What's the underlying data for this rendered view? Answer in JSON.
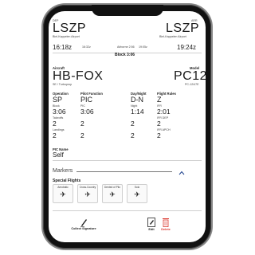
{
  "flight": {
    "dep_label": "DEP",
    "arr_label": "ARR",
    "dep_code": "LSZP",
    "arr_code": "LSZP",
    "dep_name": "Biel-Kappelen Airport",
    "arr_name": "Biel-Kappelen Airport",
    "dep_time": "16:18z",
    "arr_time": "19:24z",
    "tko_time": "16:32z",
    "airborne": "Airborne 2:56",
    "ldg_time": "19:05z",
    "block": "Block 3:06"
  },
  "aircraft": {
    "label": "Aircraft",
    "model_label": "Model",
    "reg": "HB-FOX",
    "model": "PC12",
    "sub": "SE / Turboprop",
    "model_sub": "PC-12/47E"
  },
  "stats": {
    "headers": [
      "Operation",
      "Pilot Function",
      "Day/Night",
      "Flight Rules"
    ],
    "values": [
      "SP",
      "PIC",
      "D-N",
      "Z"
    ],
    "row2_labels": [
      "Block",
      "PIC",
      "Night",
      "IFR"
    ],
    "row2_values": [
      "3:06",
      "3:06",
      "1:14",
      "2:01"
    ],
    "row3_labels": [
      "Takeoffs",
      "",
      "",
      "IFR DEP"
    ],
    "row3_values": [
      "2",
      "2",
      "2",
      "2"
    ],
    "row4_labels": [
      "Landings",
      "",
      "",
      "IFR APCH"
    ],
    "row4_values": [
      "2",
      "2",
      "2",
      "2"
    ]
  },
  "pic": {
    "label": "PIC Name",
    "value": "Self"
  },
  "markers": {
    "title": "Markers"
  },
  "special": {
    "title": "Special Flights",
    "cards": [
      "Aerobatic",
      "Cross-Country",
      "Dented of Pilo",
      "Solo"
    ]
  },
  "footer": {
    "collect": "Collect Signature",
    "edit": "Edit",
    "delete": "Delete"
  },
  "colors": {
    "delete": "#d9342b",
    "chevron": "#1b3f8b"
  }
}
